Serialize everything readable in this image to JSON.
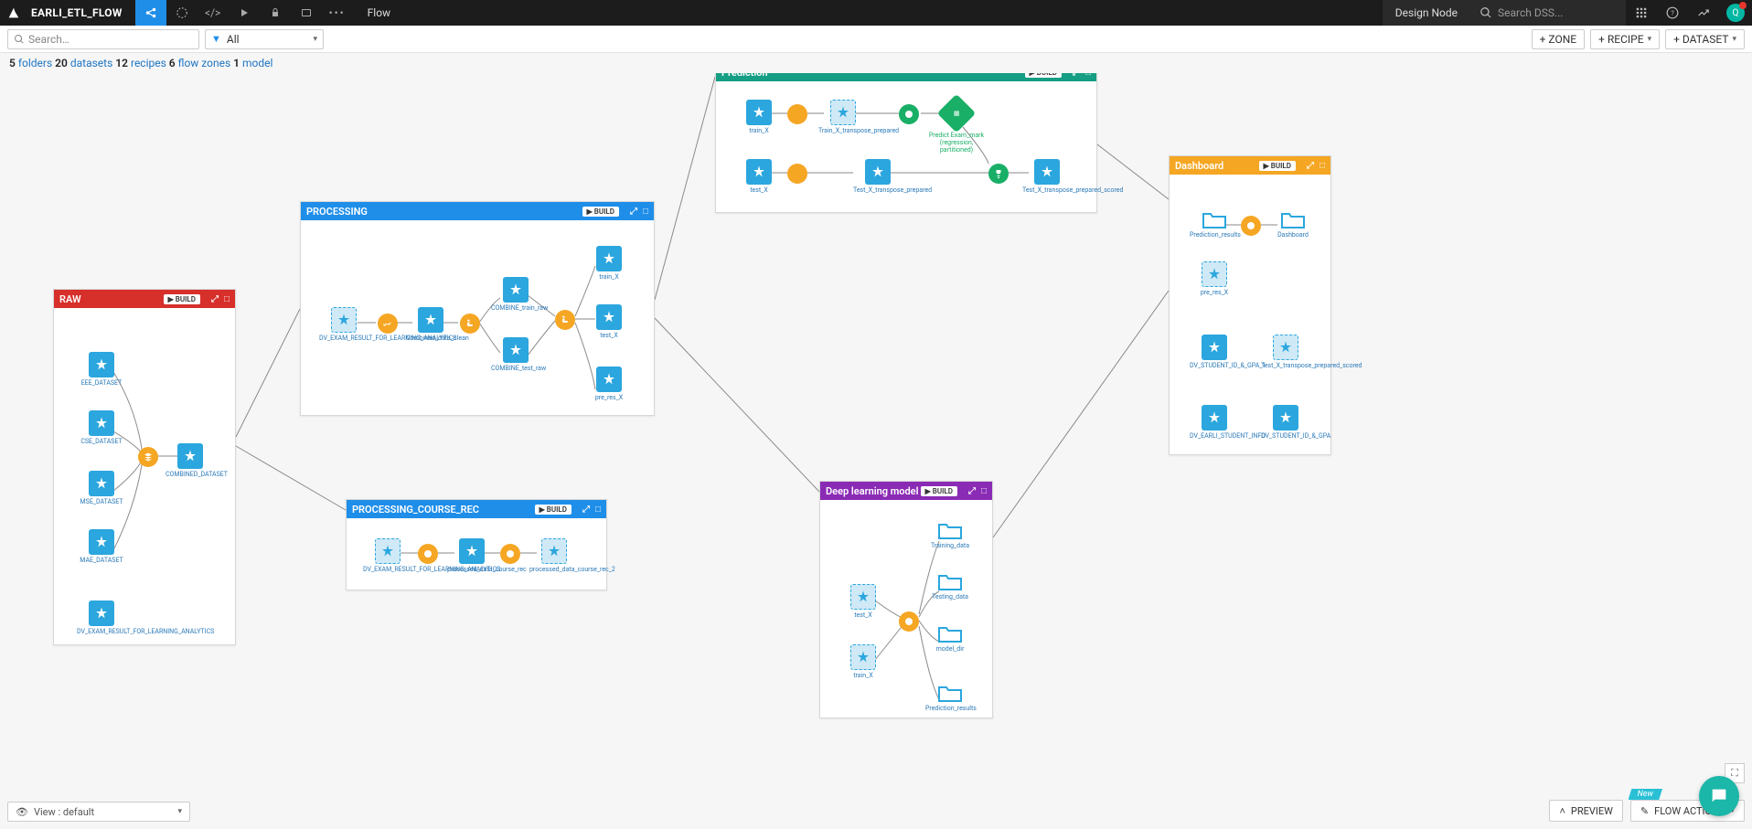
{
  "app": {
    "project_title": "EARLI_ETL_FLOW",
    "nav_label": "Flow",
    "design_node": "Design Node",
    "search_placeholder": "Search DSS..."
  },
  "toolbar": {
    "search_placeholder": "Search…",
    "filter_value": "All",
    "zone_btn": "+ ZONE",
    "recipe_btn": "+ RECIPE",
    "dataset_btn": "+ DATASET"
  },
  "summary": {
    "folders_n": "5",
    "folders_k": "folders",
    "datasets_n": "20",
    "datasets_k": "datasets",
    "recipes_n": "12",
    "recipes_k": "recipes",
    "fz_n": "6",
    "fz_k": "flow zones",
    "model_n": "1",
    "model_k": "model"
  },
  "zones": {
    "raw": {
      "title": "RAW",
      "build": "BUILD"
    },
    "processing": {
      "title": "PROCESSING",
      "build": "BUILD"
    },
    "proc_course": {
      "title": "PROCESSING_COURSE_REC",
      "build": "BUILD"
    },
    "prediction": {
      "title": "Prediction",
      "build": "BUILD"
    },
    "deep": {
      "title": "Deep learning model",
      "build": "BUILD"
    },
    "dashboard": {
      "title": "Dashboard",
      "build": "BUILD"
    }
  },
  "nodes": {
    "raw": {
      "eee": "EEE_DATASET",
      "cse": "CSE_DATASET",
      "mse": "MSE_DATASET",
      "mae": "MAE_DATASET",
      "exam": "DV_EXAM_RESULT_FOR_LEARNING_ANALYTICS",
      "combined": "COMBINED_DATASET"
    },
    "processing": {
      "in": "DV_EXAM_RESULT_FOR_LEARNING_ANALYTICS",
      "clean": "Combined_data_clean",
      "train": "COMBINE_train_raw",
      "test": "COMBINE_test_raw",
      "trainX": "train_X",
      "testX": "test_X",
      "preres": "pre_res_X"
    },
    "proc_course": {
      "in": "DV_EXAM_RESULT_FOR_LEARNING_ANALYTICS",
      "p1": "processed_data_course_rec",
      "p2": "processed_data_course_rec_2"
    },
    "prediction": {
      "trainX": "train_X",
      "testX": "test_X",
      "train_prep": "Train_X_transpose_prepared",
      "test_prep": "Test_X_transpose_prepared",
      "model": "Predict Exam_mark (regression, partitioned)",
      "scored": "Test_X_transpose_prepared_scored"
    },
    "deep": {
      "testX": "test_X",
      "trainX": "train_X",
      "training_data": "Training_data",
      "testing_data": "Testing_data",
      "model_dir": "model_dir",
      "pred_results": "Prediction_results"
    },
    "dashboard": {
      "pred_results": "Prediction_results",
      "dash": "Dashboard",
      "preres": "pre_res_X",
      "gpa1": "DV_STUDENT_ID_&_GPA_1",
      "scored": "Test_X_transpose_prepared_scored",
      "earli": "DV_EARLI_STUDENT_INFO",
      "gpa": "DV_STUDENT_ID_&_GPA"
    }
  },
  "bottom": {
    "view_label": "View : default",
    "preview": "PREVIEW",
    "flow_actions": "FLOW ACTIONS",
    "new_tag": "New"
  },
  "colors": {
    "raw": "#d72f2a",
    "processing": "#1f8ee9",
    "proc_course": "#1f8ee9",
    "prediction": "#159e83",
    "deep": "#8a2bb5",
    "dashboard": "#f5a623"
  }
}
